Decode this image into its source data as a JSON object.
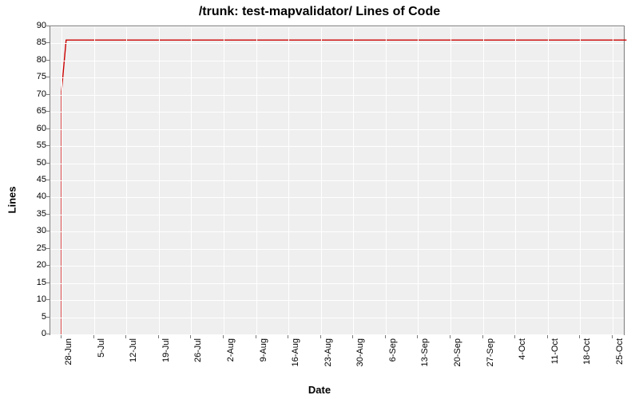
{
  "chart_data": {
    "type": "line",
    "title": "/trunk: test-mapvalidator/ Lines of Code",
    "xlabel": "Date",
    "ylabel": "Lines",
    "ylim": [
      0,
      90
    ],
    "yticks": [
      0,
      5,
      10,
      15,
      20,
      25,
      30,
      35,
      40,
      45,
      50,
      55,
      60,
      65,
      70,
      75,
      80,
      85,
      90
    ],
    "x_categories": [
      "28-Jun",
      "5-Jul",
      "12-Jul",
      "19-Jul",
      "26-Jul",
      "2-Aug",
      "9-Aug",
      "16-Aug",
      "23-Aug",
      "30-Aug",
      "6-Sep",
      "13-Sep",
      "20-Sep",
      "27-Sep",
      "4-Oct",
      "11-Oct",
      "18-Oct",
      "25-Oct"
    ],
    "series": [
      {
        "name": "Lines of Code",
        "color": "#cc0000",
        "points": [
          {
            "x": "28-Jun",
            "y": 0
          },
          {
            "x": "28-Jun",
            "y": 71
          },
          {
            "x": "29-Jun",
            "y": 86
          },
          {
            "x": "28-Oct",
            "y": 86
          }
        ]
      }
    ],
    "grid": true
  }
}
